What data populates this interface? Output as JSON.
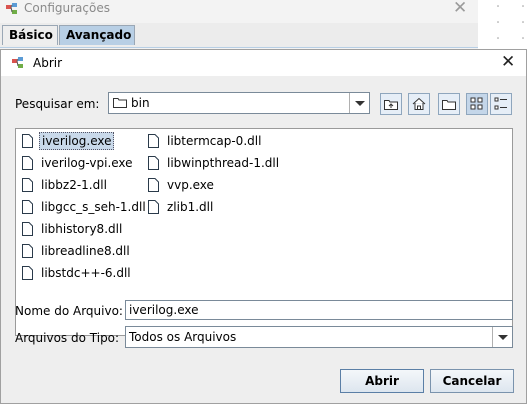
{
  "background_window": {
    "title": "Configurações",
    "tabs": [
      {
        "label": "Básico"
      },
      {
        "label": "Avançado"
      }
    ]
  },
  "dialog": {
    "title": "Abrir",
    "look_in_label": "Pesquisar em:",
    "look_in_value": "bin",
    "files": [
      {
        "name": "iverilog.exe",
        "selected": true
      },
      {
        "name": "iverilog-vpi.exe"
      },
      {
        "name": "libbz2-1.dll"
      },
      {
        "name": "libgcc_s_seh-1.dll"
      },
      {
        "name": "libhistory8.dll"
      },
      {
        "name": "libreadline8.dll"
      },
      {
        "name": "libstdc++-6.dll"
      },
      {
        "name": "libtermcap-0.dll"
      },
      {
        "name": "libwinpthread-1.dll"
      },
      {
        "name": "vvp.exe"
      },
      {
        "name": "zlib1.dll"
      }
    ],
    "file_name_label": "Nome do Arquivo:",
    "file_name_value": "iverilog.exe",
    "file_type_label": "Arquivos do Tipo:",
    "file_type_value": "Todos os Arquivos",
    "open_label": "Abrir",
    "cancel_label": "Cancelar"
  },
  "icons": {
    "app": "app-icon",
    "close": "close-icon",
    "folder": "folder-icon",
    "up_folder": "up-one-level-icon",
    "home": "home-icon",
    "new_folder": "new-folder-icon",
    "list_view": "list-view-icon",
    "details_view": "details-view-icon",
    "file": "file-icon",
    "dropdown": "chevron-down-icon"
  },
  "colors": {
    "selection": "#c9d9ea",
    "active_tab": "#b8cfe5",
    "toggle_active": "#c4d6e9"
  }
}
